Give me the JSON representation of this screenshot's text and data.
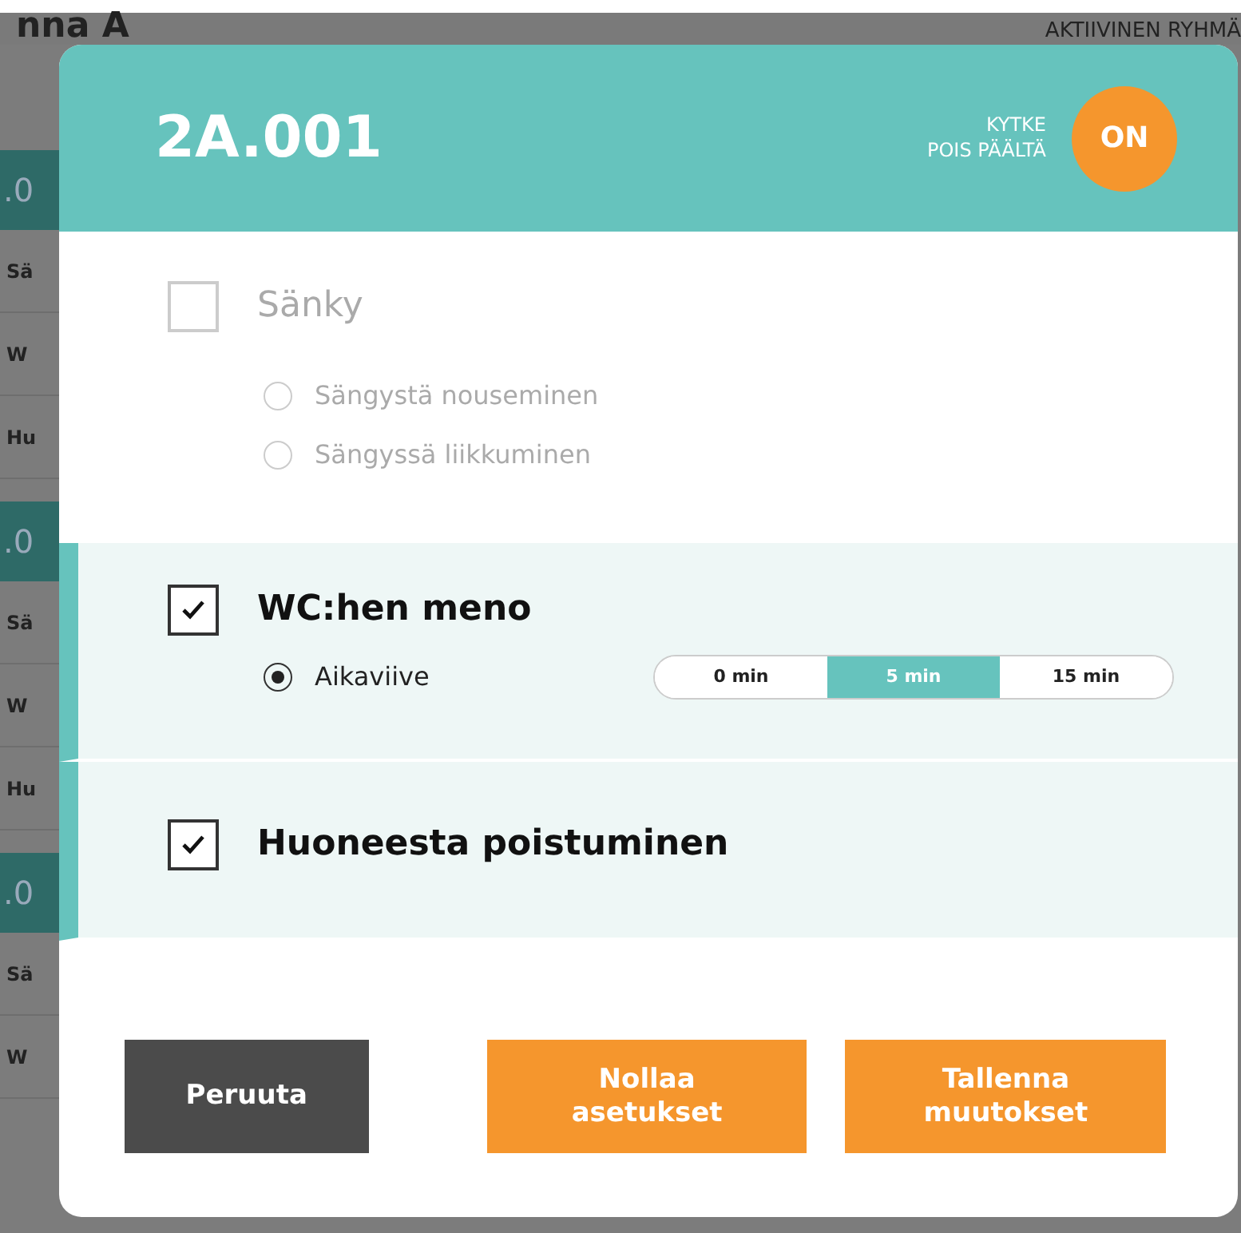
{
  "background": {
    "heading": "nna A",
    "group_label": "AKTIIVINEN RYHMÄ",
    "side_rows": [
      {
        "kind": "header",
        "text": ".0"
      },
      {
        "kind": "row",
        "text": "Sä"
      },
      {
        "kind": "row",
        "text": "W"
      },
      {
        "kind": "row",
        "text": "Hu"
      },
      {
        "kind": "header",
        "text": ".0"
      },
      {
        "kind": "row",
        "text": "Sä"
      },
      {
        "kind": "row",
        "text": "W"
      },
      {
        "kind": "row",
        "text": "Hu"
      },
      {
        "kind": "header",
        "text": ".0"
      },
      {
        "kind": "row",
        "text": "Sä"
      },
      {
        "kind": "row",
        "text": "W"
      }
    ]
  },
  "dialog": {
    "title": "2A.001",
    "toggle_label": "KYTKE\nPOIS PÄÄLTÄ",
    "toggle": {
      "label": "ON",
      "on": true
    },
    "sections": [
      {
        "label": "Sänky",
        "checked": false,
        "disabled": true,
        "options": [
          {
            "label": "Sängystä nouseminen",
            "selected": false
          },
          {
            "label": "Sängyssä liikkuminen",
            "selected": false
          }
        ]
      },
      {
        "label": "WC:hen meno",
        "checked": true,
        "disabled": false,
        "options": [
          {
            "label": "Aikaviive",
            "selected": true,
            "segments": [
              {
                "label": "0 min",
                "selected": false
              },
              {
                "label": "5 min",
                "selected": true
              },
              {
                "label": "15 min",
                "selected": false
              }
            ]
          }
        ]
      },
      {
        "label": "Huoneesta poistuminen",
        "checked": true,
        "disabled": false
      }
    ],
    "buttons": [
      {
        "label": "Peruuta",
        "kind": "cancel"
      },
      {
        "label": "Nollaa\nasetukset",
        "kind": "primary"
      },
      {
        "label": "Tallenna\nmuutokset",
        "kind": "primary"
      }
    ]
  }
}
